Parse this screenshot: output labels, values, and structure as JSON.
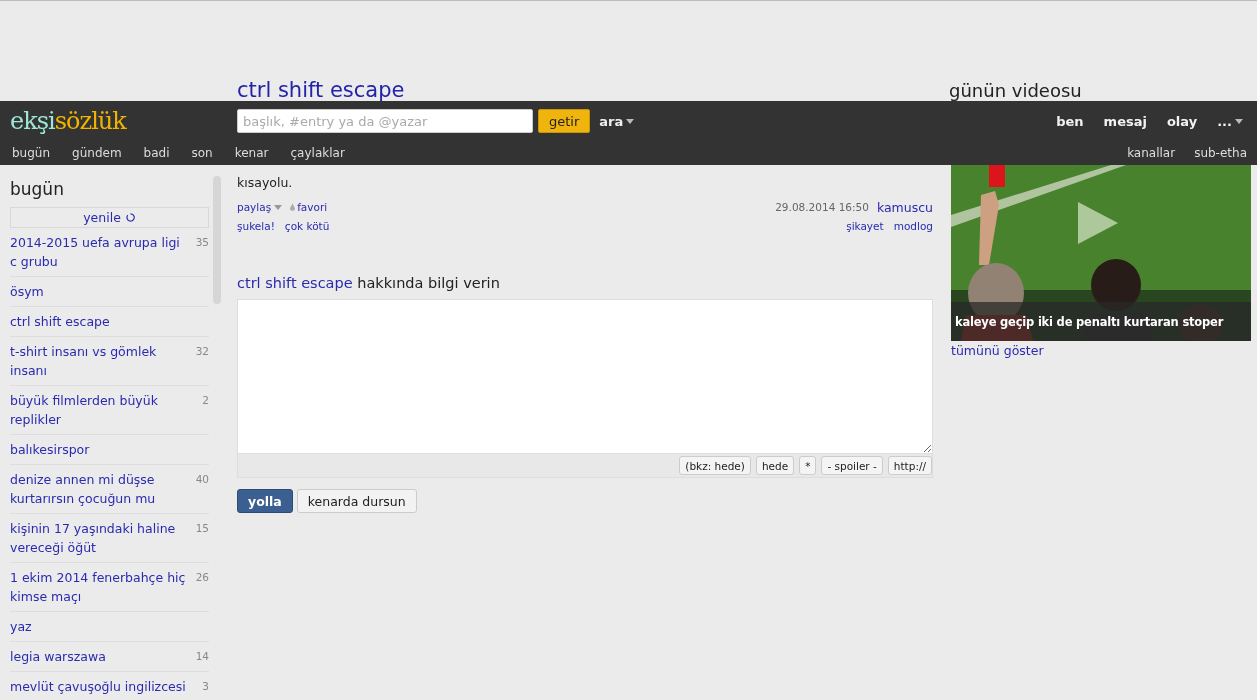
{
  "page_title": "ctrl shift escape",
  "logo": {
    "part_1": "ekşi",
    "part_2": "sözlük"
  },
  "search": {
    "placeholder": "başlık, #entry ya da @yazar",
    "button": "getir",
    "advanced": "ara"
  },
  "user_menu": [
    "ben",
    "mesaj",
    "olay",
    "..."
  ],
  "nav": [
    "bugün",
    "gündem",
    "badi",
    "son",
    "kenar",
    "çaylaklar"
  ],
  "nav_right": [
    "kanallar",
    "sub-etha"
  ],
  "sidebar": {
    "title": "bugün",
    "refresh": "yenile",
    "topics": [
      {
        "title": "2014-2015 uefa avrupa ligi c grubu",
        "count": "35"
      },
      {
        "title": "ösym"
      },
      {
        "title": "ctrl shift escape"
      },
      {
        "title": "t-shirt insanı vs gömlek insanı",
        "count": "32"
      },
      {
        "title": "büyük filmlerden büyük replikler",
        "count": "2"
      },
      {
        "title": "balıkesirspor"
      },
      {
        "title": "denize annen mi düşse kurtarırsın çocuğun mu",
        "count": "40"
      },
      {
        "title": "kişinin 17 yaşındaki haline vereceği öğüt",
        "count": "15"
      },
      {
        "title": "1 ekim 2014 fenerbahçe hiç kimse maçı",
        "count": "26"
      },
      {
        "title": "yaz"
      },
      {
        "title": "legia warszawa",
        "count": "14"
      },
      {
        "title": "mevlüt çavuşoğlu ingilizcesi",
        "count": "3"
      }
    ]
  },
  "entry": {
    "text": "kısayolu.",
    "share": "paylaş",
    "favorite": "favori",
    "date": "29.08.2014 16:50",
    "author": "kamuscu",
    "votes": [
      "şukela!",
      "çok kötü"
    ],
    "links": [
      "şikayet",
      "modlog"
    ]
  },
  "editor": {
    "topic": "ctrl shift escape",
    "heading_rest": "hakkında bilgi verin",
    "toolbar": [
      "(bkz: hede)",
      "hede",
      "*",
      "- spoiler -",
      "http://"
    ],
    "submit": "yolla",
    "draft": "kenarda dursun"
  },
  "video": {
    "title": "günün videosu",
    "caption": "kaleye geçip iki de penaltı kurtaran stoper",
    "more": "tümünü göster"
  }
}
